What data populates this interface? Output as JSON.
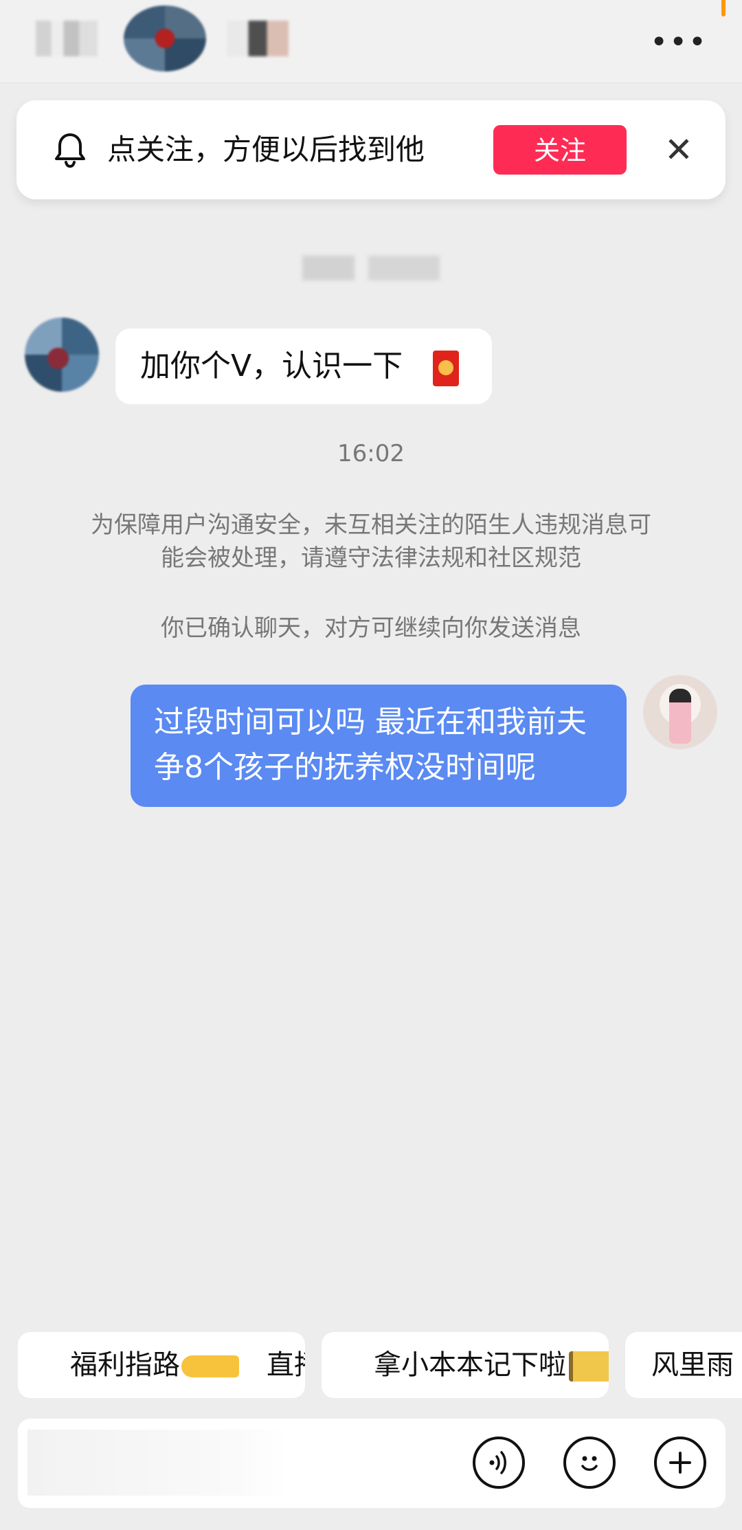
{
  "header": {
    "more_icon": "more-horizontal-icon",
    "more_text": "•••"
  },
  "follow_banner": {
    "text": "点关注，方便以后找到他",
    "button_label": "关注",
    "close_glyph": "✕",
    "bell_icon": "bell-icon",
    "accent_color": "#fe2c55"
  },
  "messages": [
    {
      "direction": "incoming",
      "text": "加你个V，认识一下",
      "has_red_packet": true
    },
    {
      "direction": "outgoing",
      "text": "过段时间可以吗 最近在和我前夫争8个孩子的抚养权没时间呢"
    }
  ],
  "timestamp": "16:02",
  "system_notice": "为保障用户沟通安全，未互相关注的陌生人违规消息可能会被处理，请遵守法律法规和社区规范",
  "confirm_notice": "你已确认聊天，对方可继续向你发送消息",
  "quick_replies": [
    {
      "before": "福利指路",
      "emoji": "pointing-hand",
      "after": "直播间"
    },
    {
      "before": "拿小本本记下啦",
      "emoji": "notebook",
      "after": ""
    },
    {
      "before": "风里雨",
      "emoji": "",
      "after": ""
    }
  ],
  "input_bar": {
    "placeholder": "",
    "icons": [
      "voice-icon",
      "emoji-icon",
      "plus-icon"
    ]
  },
  "colors": {
    "background": "#ededed",
    "outgoing_bubble": "#5a8af2",
    "incoming_bubble": "#ffffff"
  }
}
